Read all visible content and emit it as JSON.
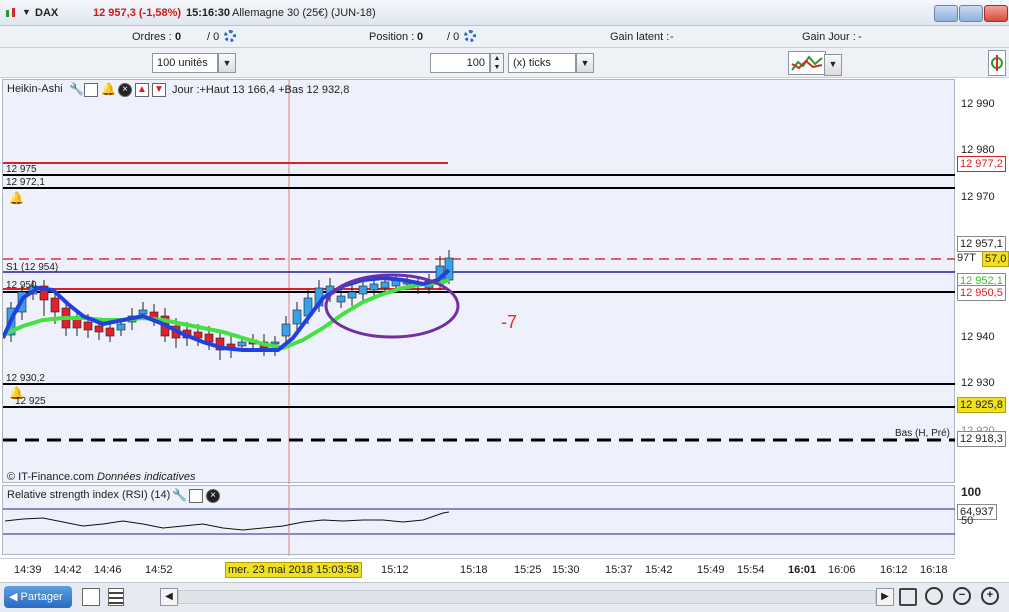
{
  "titlebar": {
    "symbol": "DAX",
    "price": "12 957,3 (-1,58%)",
    "time": "15:16:30",
    "instrument": "Allemagne 30 (25€) (JUN-18)"
  },
  "orders_bar": {
    "orders_label": "Ordres :",
    "orders_value": "0",
    "orders_total": "/ 0",
    "position_label": "Position :",
    "position_value": "0",
    "position_total": "/ 0",
    "gain_latent_label": "Gain latent :",
    "gain_latent_value": "-",
    "gain_jour_label": "Gain Jour :",
    "gain_jour_value": "-"
  },
  "toolbar": {
    "units_select": "100 unités",
    "ticks_value": "100",
    "ticks_unit_select": "(x) ticks"
  },
  "chart": {
    "indicator_name": "Heikin-Ashi",
    "day_info": "Jour :+Haut 13 166,4 +Bas 12 932,8",
    "levels": {
      "l12975": "12 975",
      "l12972": "12 972,1",
      "s1": "S1 (12 954)",
      "l12950": "12 950",
      "l12930": "12 930,2",
      "l12925": "12 925",
      "bas": "Bas (H, Pré)"
    },
    "annotation": "-7",
    "copyright": "© IT-Finance.com",
    "disclaimer": "Données indicatives",
    "hover_date": "mer. 23 mai 2018 15:03:58"
  },
  "y_axis": {
    "ticks": [
      "12 990",
      "12 980",
      "12 970",
      "12 940",
      "12 930",
      "12 920"
    ],
    "boxes": {
      "b977": "12 977,2",
      "b957": "12 957,1",
      "b97t": "97T",
      "b570": "57,0",
      "b952": "12 952,1",
      "b9505": "12 950,5",
      "b9258": "12 925,8",
      "b9183": "12 918,3"
    }
  },
  "rsi": {
    "title": "Relative strength index (RSI) (14)",
    "tick_100": "100",
    "value": "64,937",
    "tick_50": "50"
  },
  "x_axis": {
    "ticks": [
      "14:39",
      "14:42",
      "14:46",
      "14:52",
      "15:12",
      "15:18",
      "15:25",
      "15:30",
      "15:37",
      "15:42",
      "15:49",
      "15:54",
      "16:01",
      "16:06",
      "16:12",
      "16:18"
    ]
  },
  "bottom": {
    "share_label": "Partager"
  },
  "colors": {
    "bull": "#3aa0e8",
    "bear": "#e0202a",
    "ema_fast": "#2040e0",
    "ema_slow": "#44e044",
    "resistance": "#e02020",
    "ellipse": "#7030a0"
  }
}
